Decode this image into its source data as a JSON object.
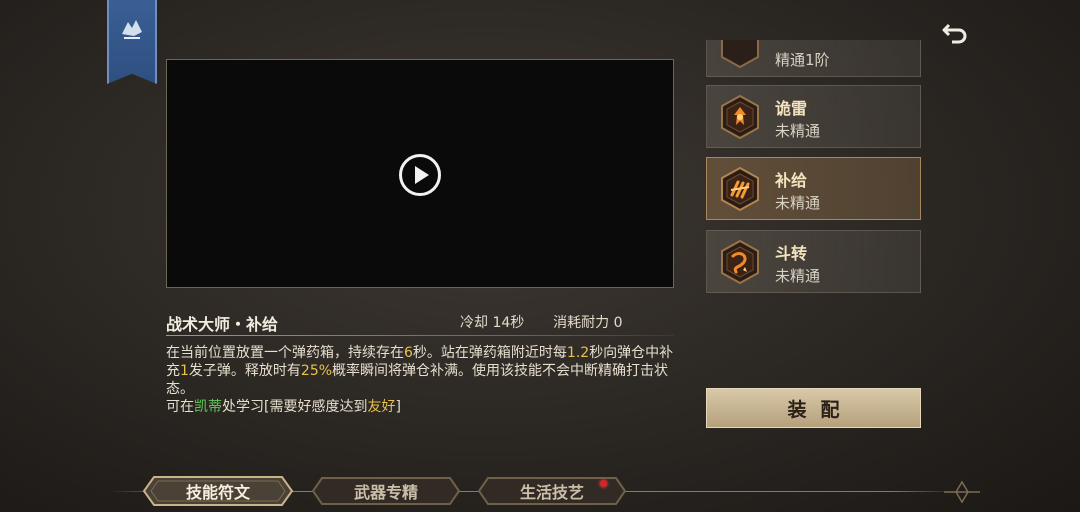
{
  "video": {
    "play_label": "play"
  },
  "skill": {
    "title": "战术大师・补给",
    "cooldown": "冷却 14秒",
    "cost": "消耗耐力 0",
    "description": {
      "p1": "在当前位置放置一个弹药箱，持续存在",
      "v1": "6",
      "p2": "秒。站在弹药箱附近时每",
      "v2": "1.2",
      "p3": "秒向弹仓中补充",
      "v3": "1",
      "p4": "发子弹。释放时有",
      "v4": "25%",
      "p5": "概率瞬间将弹仓补满。使用该技能不会中断精确打击状态。",
      "learn_prefix": "可在",
      "npc": "凯蒂",
      "learn_mid": "处学习[需要好感度达到",
      "affinity": "友好",
      "learn_suffix": "]"
    }
  },
  "skill_list": [
    {
      "name": "",
      "status": "精通1阶",
      "icon": "skill-rune-icon",
      "selected": false
    },
    {
      "name": "诡雷",
      "status": "未精通",
      "icon": "booby-trap-icon",
      "selected": false
    },
    {
      "name": "补给",
      "status": "未精通",
      "icon": "supply-icon",
      "selected": true
    },
    {
      "name": "斗转",
      "status": "未精通",
      "icon": "reversal-icon",
      "selected": false
    }
  ],
  "equip_label": "装配",
  "tabs": [
    {
      "label": "技能符文",
      "active": true
    },
    {
      "label": "武器专精",
      "active": false
    },
    {
      "label": "生活技艺",
      "active": false,
      "badge": true
    }
  ],
  "colors": {
    "accent_yellow": "#e8c24a",
    "accent_green": "#62c95a",
    "badge_red": "#d8232a"
  }
}
